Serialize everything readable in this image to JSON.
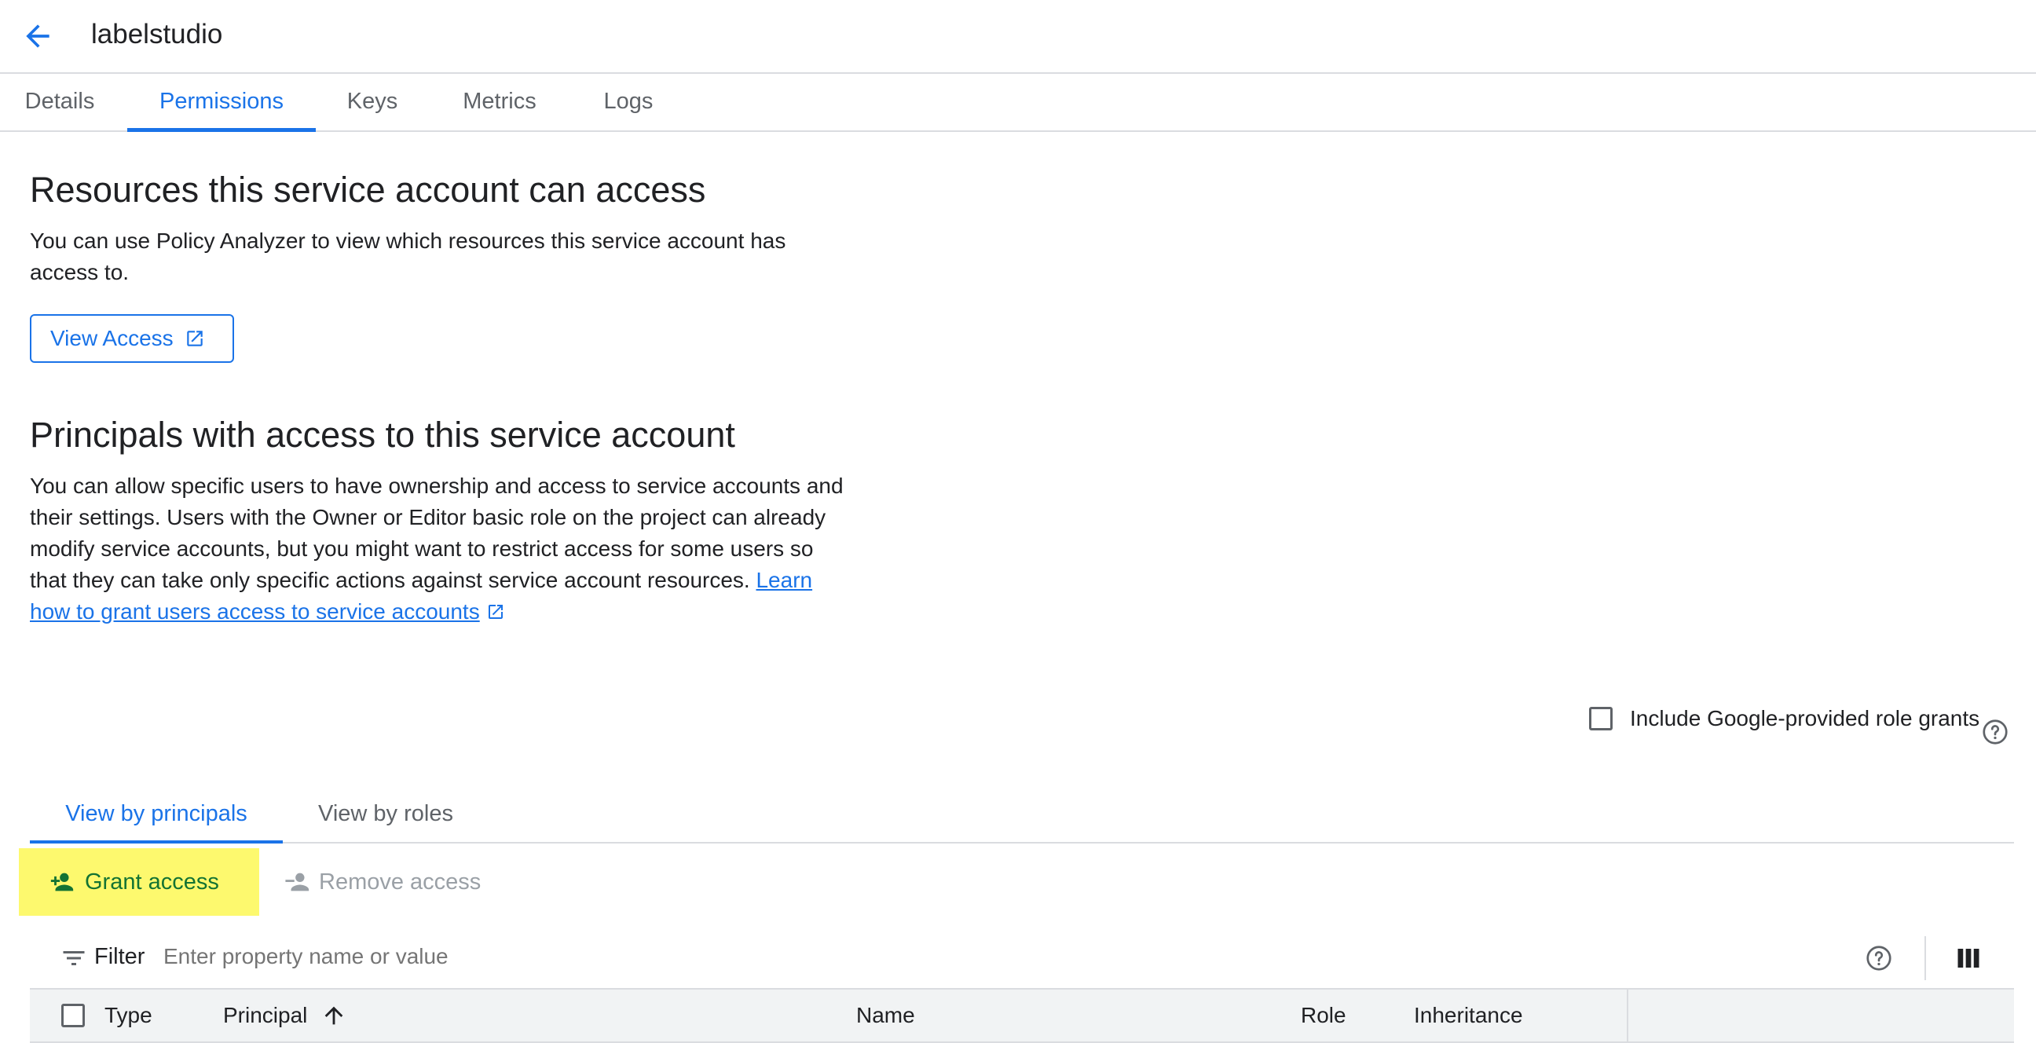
{
  "header": {
    "title": "labelstudio"
  },
  "tabs": [
    {
      "label": "Details"
    },
    {
      "label": "Permissions"
    },
    {
      "label": "Keys"
    },
    {
      "label": "Metrics"
    },
    {
      "label": "Logs"
    }
  ],
  "resources": {
    "heading": "Resources this service account can access",
    "description": "You can use Policy Analyzer to view which resources this service account has access to.",
    "button_label": "View Access"
  },
  "principals": {
    "heading": "Principals with access to this service account",
    "description": "You can allow specific users to have ownership and access to service accounts and their settings. Users with the Owner or Editor basic role on the project can already modify service accounts, but you might want to restrict access for some users so that they can take only specific actions against service account resources.",
    "link_text": "Learn how to grant users access to service accounts"
  },
  "include_google_grants": {
    "label": "Include Google-provided role grants",
    "checked": false
  },
  "subtabs": [
    {
      "label": "View by principals"
    },
    {
      "label": "View by roles"
    }
  ],
  "actions": {
    "grant_label": "Grant access",
    "remove_label": "Remove access"
  },
  "filter": {
    "label": "Filter",
    "placeholder": "Enter property name or value"
  },
  "table": {
    "columns": [
      "Type",
      "Principal",
      "Name",
      "Role",
      "Inheritance"
    ]
  },
  "colors": {
    "accent": "#1a73e8",
    "highlight": "#fdf96e",
    "grant_text": "#137333"
  },
  "icons": [
    "arrow-back-icon",
    "external-link-icon",
    "help-icon",
    "person-add-icon",
    "person-remove-icon",
    "filter-icon",
    "column-display-icon",
    "arrow-upward-icon"
  ]
}
